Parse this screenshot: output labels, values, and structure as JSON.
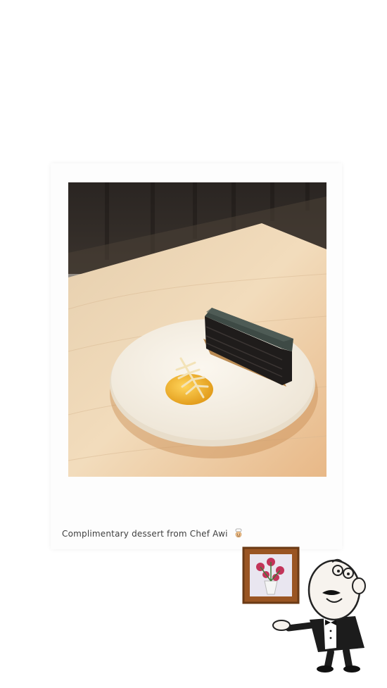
{
  "caption": {
    "text": "Complimentary dessert from Chef Awi",
    "emoji_icon": "chef-face-icon"
  },
  "photo": {
    "subject": "dessert-plate-photo"
  },
  "illustration": {
    "subject": "waiter-with-painting-illustration"
  }
}
